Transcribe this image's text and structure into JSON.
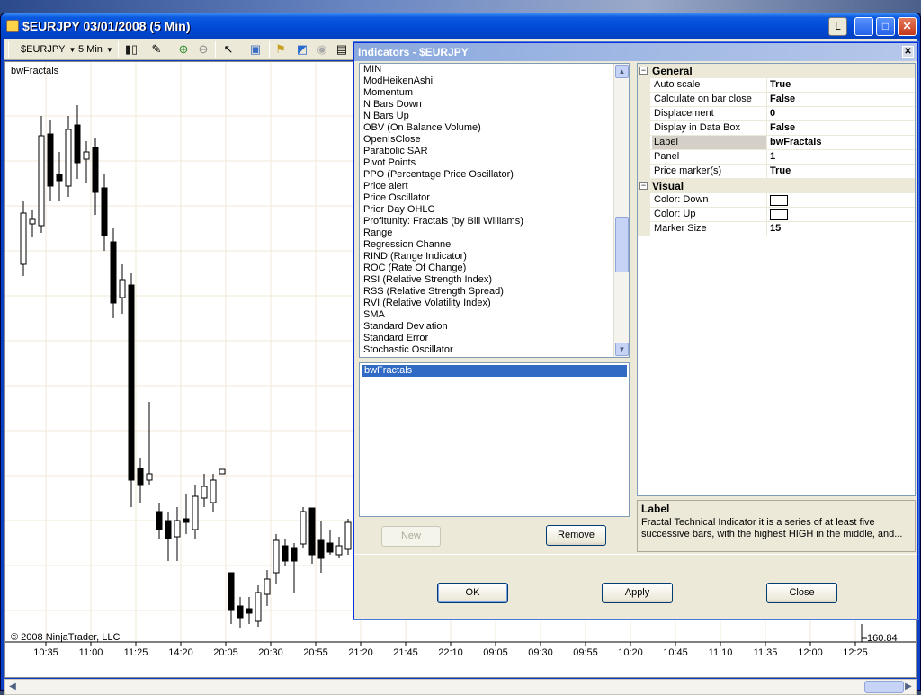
{
  "window": {
    "title": "$EURJPY  03/01/2008  (5 Min)",
    "layout_button": "L",
    "minimize": "_",
    "maximize": "□",
    "close": "✕"
  },
  "toolbar": {
    "instrument": "$EURJPY",
    "interval": "5 Min"
  },
  "chart": {
    "indicator_label": "bwFractals",
    "copyright": "© 2008 NinjaTrader, LLC",
    "price_label": "160.84",
    "time_ticks": [
      "10:35",
      "11:00",
      "11:25",
      "14:20",
      "20:05",
      "20:30",
      "20:55",
      "21:20",
      "21:45",
      "22:10",
      "09:05",
      "09:30",
      "09:55",
      "10:20",
      "10:45",
      "11:10",
      "11:35",
      "12:00",
      "12:25"
    ],
    "up_color": "#ffffff",
    "down_color": "#000000"
  },
  "dialog": {
    "title": "Indicators - $EURJPY",
    "close": "✕",
    "indicator_list": [
      "MIN",
      "ModHeikenAshi",
      "Momentum",
      "N Bars Down",
      "N Bars Up",
      "OBV (On Balance Volume)",
      "OpenIsClose",
      "Parabolic SAR",
      "Pivot Points",
      "PPO (Percentage Price Oscillator)",
      "Price alert",
      "Price Oscillator",
      "Prior Day OHLC",
      "Profitunity: Fractals (by Bill Williams)",
      "Range",
      "Regression Channel",
      "RIND (Range Indicator)",
      "ROC (Rate Of Change)",
      "RSI (Relative Strength Index)",
      "RSS (Relative Strength Spread)",
      "RVI (Relative Volatility Index)",
      "SMA",
      "Standard Deviation",
      "Standard Error",
      "Stochastic Oscillator"
    ],
    "active_indicator": "bwFractals",
    "new_button": "New",
    "remove_button": "Remove",
    "ok_button": "OK",
    "apply_button": "Apply",
    "close_button": "Close",
    "properties": {
      "general_title": "General",
      "general": [
        {
          "name": "Auto scale",
          "value": "True"
        },
        {
          "name": "Calculate on bar close",
          "value": "False"
        },
        {
          "name": "Displacement",
          "value": "0"
        },
        {
          "name": "Display in Data Box",
          "value": "False"
        },
        {
          "name": "Label",
          "value": "bwFractals"
        },
        {
          "name": "Panel",
          "value": "1"
        },
        {
          "name": "Price marker(s)",
          "value": "True"
        }
      ],
      "visual_title": "Visual",
      "visual": [
        {
          "name": "Color: Down",
          "value": ""
        },
        {
          "name": "Color: Up",
          "value": ""
        },
        {
          "name": "Marker Size",
          "value": "15"
        }
      ]
    },
    "description": {
      "title": "Label",
      "text": "Fractal Technical Indicator it is a series of at least five successive bars, with the highest HIGH in the middle, and..."
    }
  }
}
